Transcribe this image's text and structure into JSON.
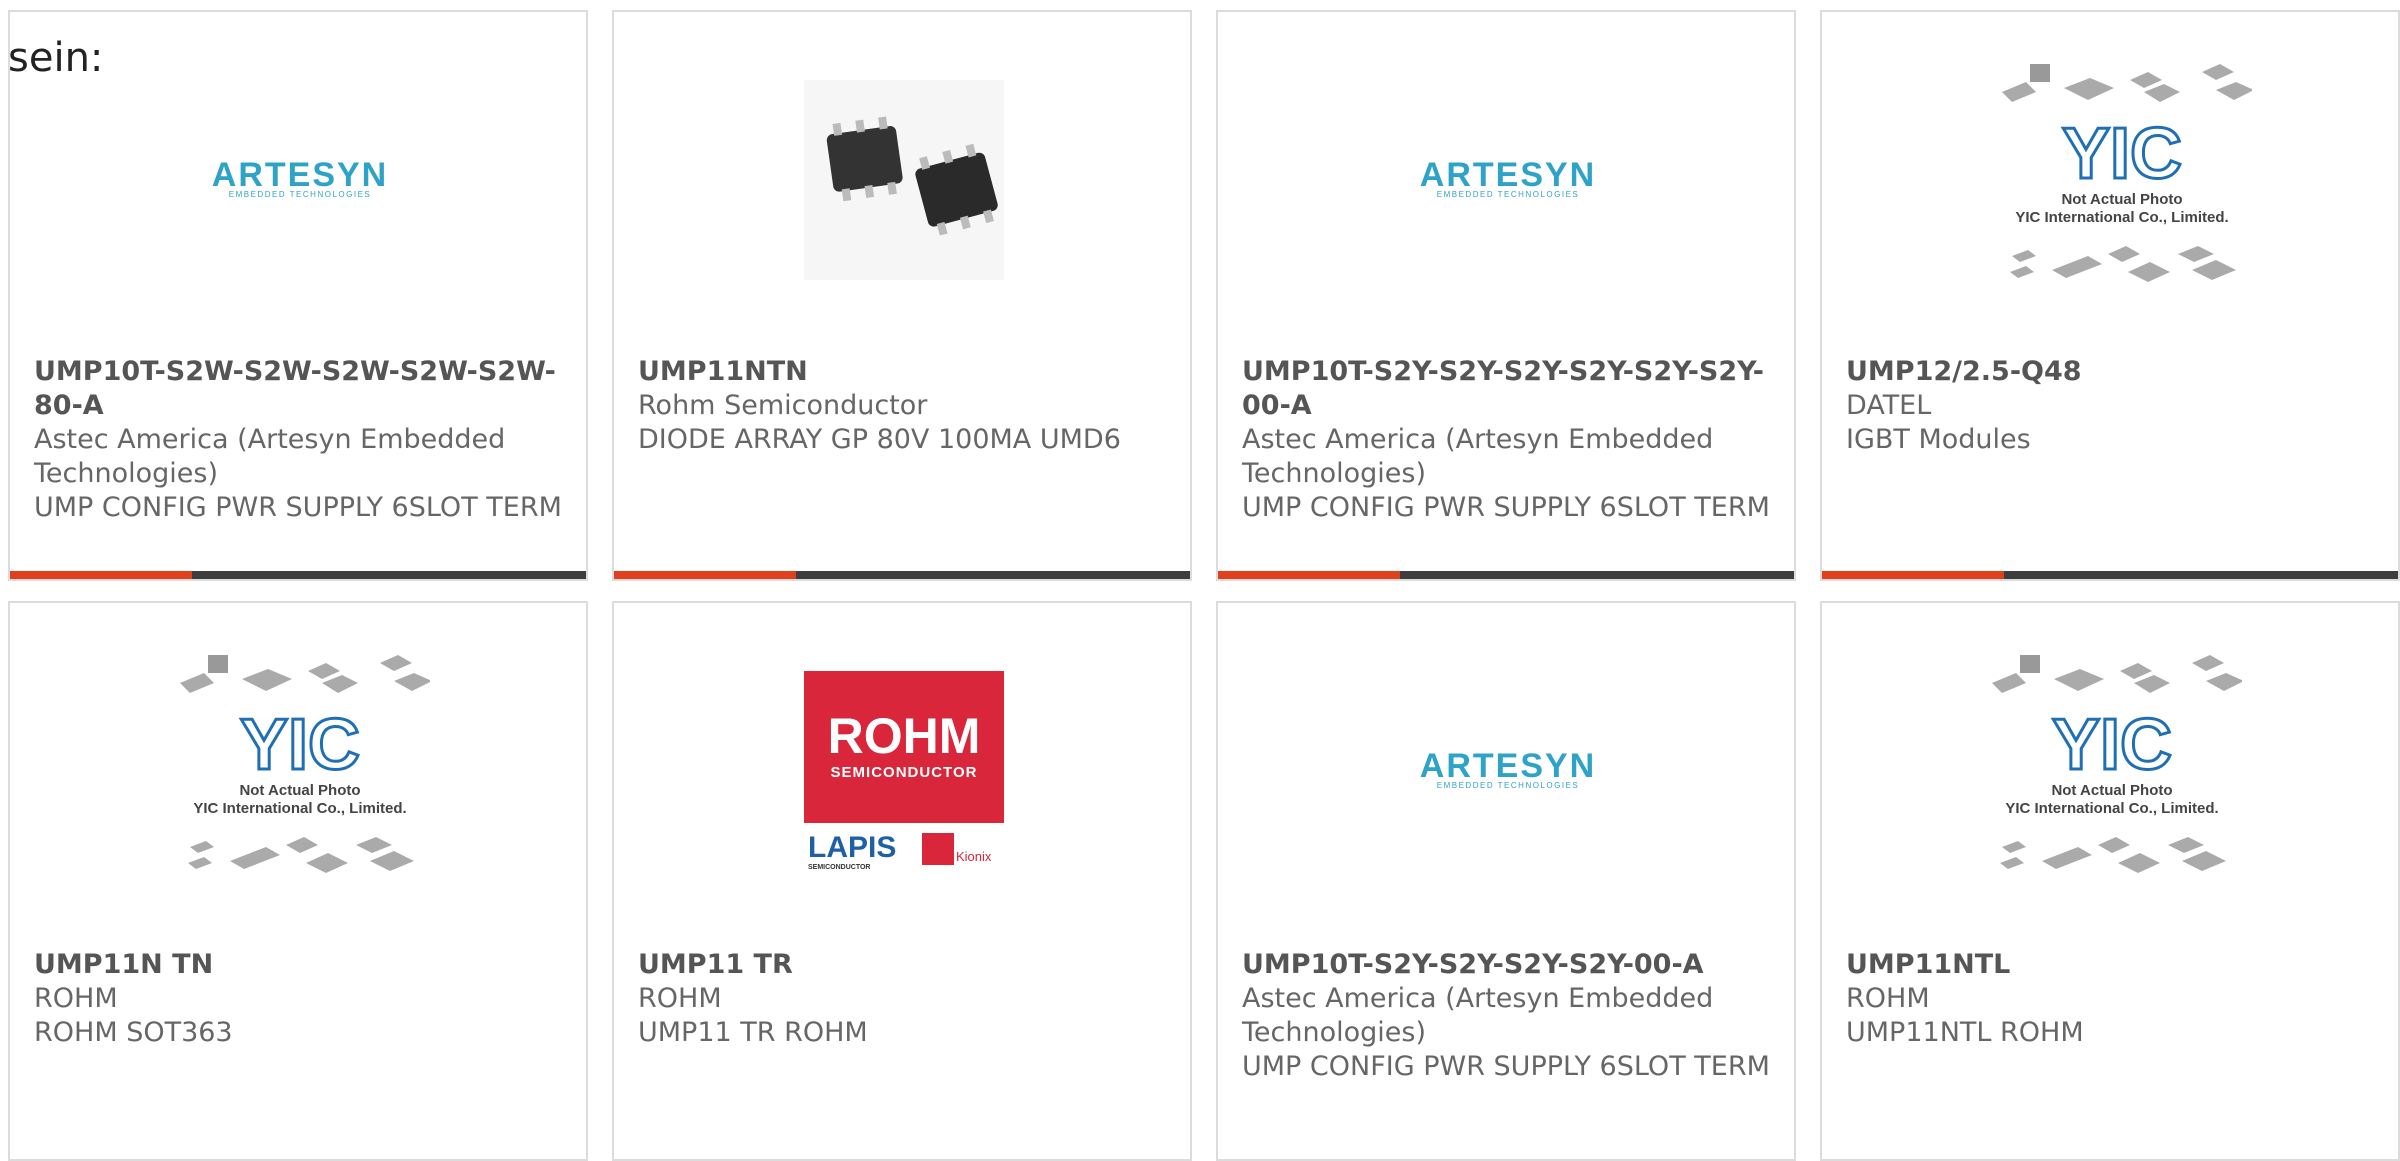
{
  "intro_text": "sein:",
  "products": [
    {
      "part": "UMP10T-S2W-S2W-S2W-S2W-S2W-80-A",
      "maker": "Astec America (Artesyn Embedded Technologies)",
      "desc": "UMP CONFIG PWR SUPPLY 6SLOT TERM",
      "image": "artesyn-logo"
    },
    {
      "part": "UMP11NTN",
      "maker": "Rohm Semiconductor",
      "desc": "DIODE ARRAY GP 80V 100MA UMD6",
      "image": "chip-photo"
    },
    {
      "part": "UMP10T-S2Y-S2Y-S2Y-S2Y-S2Y-S2Y-00-A",
      "maker": "Astec America (Artesyn Embedded Technologies)",
      "desc": "UMP CONFIG PWR SUPPLY 6SLOT TERM",
      "image": "artesyn-logo"
    },
    {
      "part": "UMP12/2.5-Q48",
      "maker": "DATEL",
      "desc": "IGBT Modules",
      "image": "yic-placeholder"
    },
    {
      "part": "UMP11N TN",
      "maker": "ROHM",
      "desc": "ROHM SOT363",
      "image": "yic-placeholder"
    },
    {
      "part": "UMP11 TR",
      "maker": "ROHM",
      "desc": "UMP11 TR ROHM",
      "image": "rohm-logo"
    },
    {
      "part": "UMP10T-S2Y-S2Y-S2Y-S2Y-00-A",
      "maker": "Astec America (Artesyn Embedded Technologies)",
      "desc": "UMP CONFIG PWR SUPPLY 6SLOT TERM",
      "image": "artesyn-logo"
    },
    {
      "part": "UMP11NTL",
      "maker": "ROHM",
      "desc": "UMP11NTL ROHM",
      "image": "yic-placeholder"
    }
  ],
  "logos": {
    "artesyn": {
      "word": "ARTESYN",
      "tagline": "EMBEDDED TECHNOLOGIES"
    },
    "yic": {
      "mark": "YIC",
      "line1": "Not Actual Photo",
      "line2": "YIC International Co., Limited."
    },
    "rohm": {
      "word": "ROHM",
      "sub": "SEMICONDUCTOR",
      "lapis": "LAPIS",
      "lapis_sub": "SEMICONDUCTOR",
      "kionix": "Kionix"
    }
  },
  "colors": {
    "accent": "#e0401b",
    "bar": "#3d3d3d",
    "rohm_red": "#d9263a",
    "artesyn_blue": "#2fa3c7",
    "lapis_blue": "#1f5fa8"
  }
}
